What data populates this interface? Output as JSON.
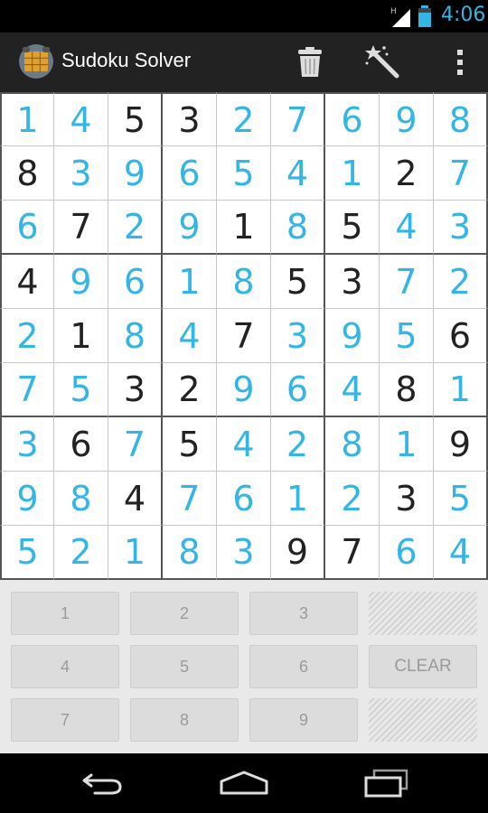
{
  "status_bar": {
    "time": "4:06",
    "network_label": "H"
  },
  "action_bar": {
    "title": "Sudoku Solver",
    "actions": [
      "delete-icon",
      "magic-wand-icon",
      "overflow-menu-icon"
    ]
  },
  "colors": {
    "accent": "#33b5e5",
    "given": "#222222",
    "action_bar": "#222222",
    "keypad_bg": "#e9e9e9"
  },
  "board": {
    "rows": [
      [
        "1",
        "4",
        "5",
        "3",
        "2",
        "7",
        "6",
        "9",
        "8"
      ],
      [
        "8",
        "3",
        "9",
        "6",
        "5",
        "4",
        "1",
        "2",
        "7"
      ],
      [
        "6",
        "7",
        "2",
        "9",
        "1",
        "8",
        "5",
        "4",
        "3"
      ],
      [
        "4",
        "9",
        "6",
        "1",
        "8",
        "5",
        "3",
        "7",
        "2"
      ],
      [
        "2",
        "1",
        "8",
        "4",
        "7",
        "3",
        "9",
        "5",
        "6"
      ],
      [
        "7",
        "5",
        "3",
        "2",
        "9",
        "6",
        "4",
        "8",
        "1"
      ],
      [
        "3",
        "6",
        "7",
        "5",
        "4",
        "2",
        "8",
        "1",
        "9"
      ],
      [
        "9",
        "8",
        "4",
        "7",
        "6",
        "1",
        "2",
        "3",
        "5"
      ],
      [
        "5",
        "2",
        "1",
        "8",
        "3",
        "9",
        "7",
        "6",
        "4"
      ]
    ],
    "given": [
      [
        0,
        0,
        1,
        1,
        0,
        0,
        0,
        0,
        0
      ],
      [
        1,
        0,
        0,
        0,
        0,
        0,
        0,
        1,
        0
      ],
      [
        0,
        1,
        0,
        0,
        1,
        0,
        1,
        0,
        0
      ],
      [
        1,
        0,
        0,
        0,
        0,
        1,
        1,
        0,
        0
      ],
      [
        0,
        1,
        0,
        0,
        1,
        0,
        0,
        0,
        1
      ],
      [
        0,
        0,
        1,
        1,
        0,
        0,
        0,
        1,
        0
      ],
      [
        0,
        1,
        0,
        1,
        0,
        0,
        0,
        0,
        1
      ],
      [
        0,
        0,
        1,
        0,
        0,
        0,
        0,
        1,
        0
      ],
      [
        0,
        0,
        0,
        0,
        0,
        1,
        1,
        0,
        0
      ]
    ]
  },
  "keypad": {
    "keys": [
      "1",
      "2",
      "3",
      "4",
      "5",
      "6",
      "7",
      "8",
      "9"
    ],
    "clear_label": "CLEAR"
  },
  "nav_bar": {
    "buttons": [
      "back-icon",
      "home-icon",
      "recents-icon"
    ]
  }
}
